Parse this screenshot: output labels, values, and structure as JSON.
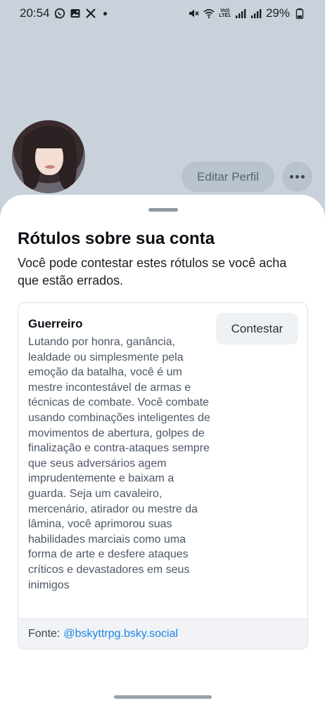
{
  "status_bar": {
    "time": "20:54",
    "volte_top": "Vo))",
    "volte_bottom": "LTE1",
    "battery": "29%"
  },
  "profile": {
    "edit_label": "Editar Perfil",
    "more_label": "•••"
  },
  "sheet": {
    "title": "Rótulos sobre sua conta",
    "subtitle": "Você pode contestar estes rótulos se você acha que estão errados.",
    "label": {
      "name": "Guerreiro",
      "contest_label": "Contestar",
      "description": "Lutando por honra, ganância, lealdade ou simplesmente pela emoção da batalha, você é um mestre incontestável de armas e técnicas de combate. Você combate usando combinações inteligentes de movimentos de abertura, golpes de finalização e contra-ataques sempre que seus adversários agem imprudentemente e baixam a guarda. Seja um cavaleiro, mercenário, atirador ou mestre da lâmina, você aprimorou suas habilidades marciais como uma forma de arte e desfere ataques críticos e devastadores em seus inimigos",
      "source_prefix": "Fonte:",
      "source_handle": "@bskyttrpg.bsky.social"
    }
  },
  "icons": [
    "whatsapp-icon",
    "gallery-icon",
    "x-icon",
    "mute-icon",
    "wifi-icon",
    "signal-icon",
    "battery-icon"
  ],
  "colors": {
    "backdrop": "#c9d1db",
    "link": "#1c86e8",
    "sheet": "#ffffff"
  }
}
